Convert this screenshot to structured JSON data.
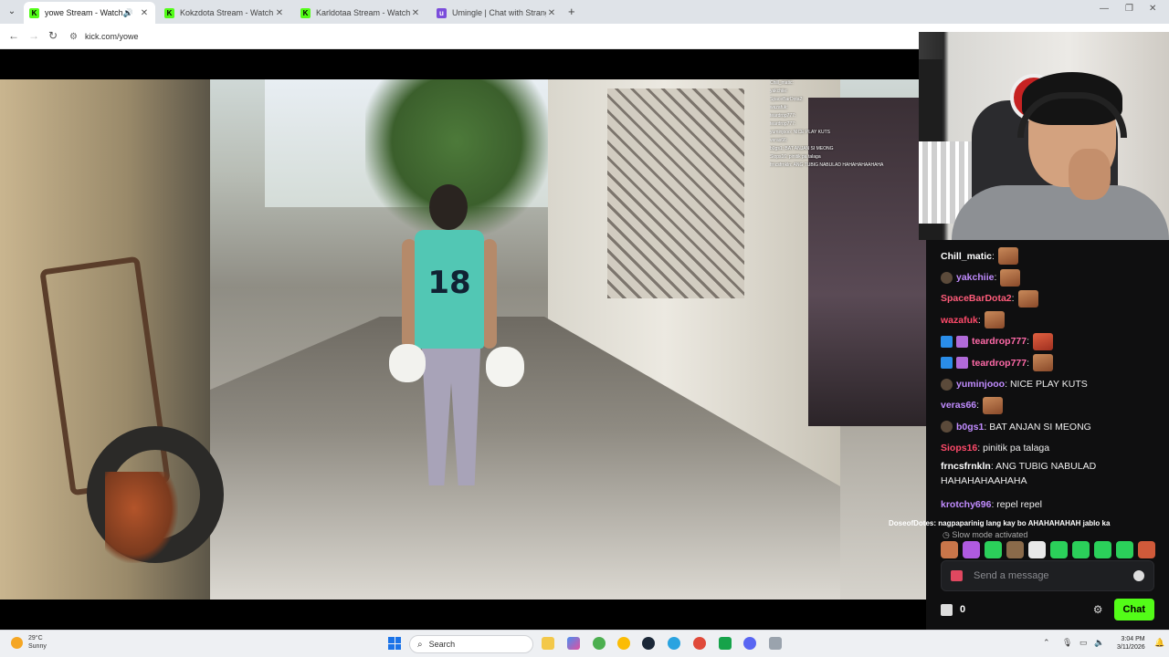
{
  "browser": {
    "tabs": [
      {
        "title": "yowe Stream - Watch Live o",
        "favicon": "kick-icon",
        "active": true,
        "audio": true
      },
      {
        "title": "Kokzdota Stream - Watch Live o",
        "favicon": "kick-icon",
        "active": false
      },
      {
        "title": "Karldotaa Stream - Watch Live o",
        "favicon": "kick-icon",
        "active": false
      },
      {
        "title": "Umingle | Chat with Strangers o",
        "favicon": "umingle-icon",
        "active": false
      }
    ],
    "url": "kick.com/yowe"
  },
  "video_overlay_chat": [
    "Chill_matic:",
    "yakchiie:",
    "SpaceBarDota2:",
    "wazafuk:",
    "teardrop777:",
    "teardrop777:",
    "yuminjooo: NICE PLAY KUTS",
    "veras66:",
    "b0gs1: BAT ANJAN SI MEONG",
    "Siops16: pinitik pa talaga",
    "frncsfrnkln: ANG TUBIG NABULAD HAHAHAHAAHAHA"
  ],
  "video": {
    "jersey_number": "18"
  },
  "chat": {
    "messages": [
      {
        "user": "Chill_matic",
        "color": "#ffffff",
        "badges": [],
        "text": "",
        "emote": true
      },
      {
        "user": "yakchiie",
        "color": "#c18cff",
        "badges": [
          "lvl"
        ],
        "text": "",
        "emote": true
      },
      {
        "user": "SpaceBarDota2",
        "color": "#ff5c7a",
        "badges": [],
        "text": "",
        "emote": true
      },
      {
        "user": "wazafuk",
        "color": "#ff4a6a",
        "badges": [],
        "text": "",
        "emote": true
      },
      {
        "user": "teardrop777",
        "color": "#ff6aa8",
        "badges": [
          "prime",
          "gift"
        ],
        "text": "",
        "emote": true
      },
      {
        "user": "teardrop777",
        "color": "#ff6aa8",
        "badges": [
          "prime",
          "gift"
        ],
        "text": "",
        "emote": true
      },
      {
        "user": "yuminjooo",
        "color": "#c18cff",
        "badges": [
          "lvl"
        ],
        "text": "NICE PLAY KUTS",
        "emote": false
      },
      {
        "user": "veras66",
        "color": "#c18cff",
        "badges": [],
        "text": "",
        "emote": true
      },
      {
        "user": "b0gs1",
        "color": "#c18cff",
        "badges": [
          "lvl"
        ],
        "text": "BAT ANJAN SI MEONG",
        "emote": false
      },
      {
        "user": "Siops16",
        "color": "#ff4a6a",
        "badges": [],
        "text": "pinitik pa talaga",
        "emote": false
      },
      {
        "user": "frncsfrnkln",
        "color": "#ffffff",
        "badges": [],
        "text": "ANG TUBIG NABULAD HAHAHAHAAHAHA",
        "emote": false,
        "wrap": true
      },
      {
        "user": "krotchy696",
        "color": "#c18cff",
        "badges": [],
        "text": "repel repel",
        "emote": false
      }
    ],
    "incoming_line": {
      "user": "DoseofDotes",
      "text": "nagpaparinig lang kay bo AHAHAHAHAH jablo ka"
    },
    "slow_mode_text": "Slow mode activated",
    "quick_emotes": [
      "#c9764a",
      "#b05ae0",
      "#2bd05a",
      "#8a6a4a",
      "#e8e8e8",
      "#2bd05a",
      "#2bd05a",
      "#2bd05a",
      "#2bd05a",
      "#d05a3a"
    ],
    "input_placeholder": "Send a message",
    "points": "0",
    "send_label": "Chat"
  },
  "taskbar": {
    "weather_temp": "29°C",
    "weather_desc": "Sunny",
    "search_label": "Search",
    "time": "3:04 PM",
    "date": "3/11/2026"
  }
}
